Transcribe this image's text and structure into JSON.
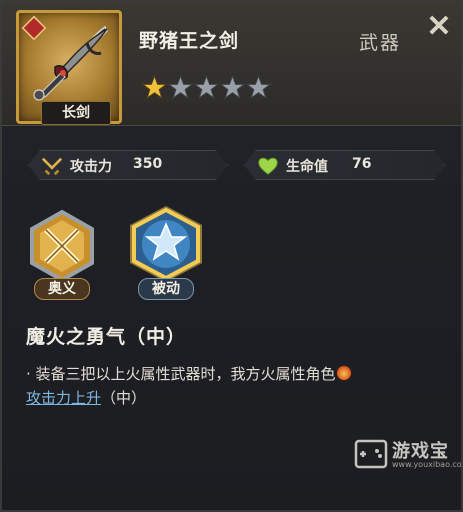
{
  "item": {
    "name": "野猪王之剑",
    "category": "武器",
    "type_label": "长剑",
    "stars_total": 5,
    "stars_filled": 1
  },
  "stats": {
    "attack_label": "攻击力",
    "attack_value": "350",
    "hp_label": "生命值",
    "hp_value": "76"
  },
  "skills": {
    "ougi_label": "奥义",
    "passive_label": "被动"
  },
  "skill_detail": {
    "name": "魔火之勇气（中）",
    "desc_prefix": "· 装备三把以上火属性武器时，我方火属性角色",
    "desc_link": "攻击力上升",
    "desc_suffix": "（中）"
  },
  "watermark": {
    "text": "游戏宝",
    "url": "www.youxibao.com"
  },
  "colors": {
    "gold_frame": "#c69a3a",
    "link": "#7fb6de",
    "star_filled": "#f0c23b",
    "star_empty": "#9aa0a8"
  },
  "icons": {
    "close": "close-icon",
    "attack": "crossed-swords-icon",
    "hp": "heart-icon",
    "fire": "fire-element-icon"
  }
}
